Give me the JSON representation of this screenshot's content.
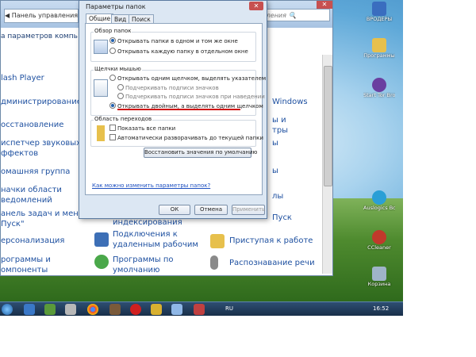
{
  "cp": {
    "address": "Панель управления",
    "search": "управления",
    "subheader": "а параметров компь",
    "view": "ры",
    "left_items": [
      "lash Player",
      "дминистрирование",
      "осстановление",
      "испетчер звуковых",
      "ффектов",
      "омашняя группа",
      "начки области",
      "ведомлений",
      "анель задач и меню",
      "Пуск\"",
      "ерсонализация",
      "рограммы и",
      "омпоненты"
    ],
    "mid_items": [
      "индексирования",
      "Подключения к",
      "удаленным рабочим",
      "Программы по",
      "умолчанию"
    ],
    "right_items": [
      "Windows",
      "ы и",
      "тры",
      "ы",
      "ы",
      "лы",
      "Пуск",
      "Приступая к работе",
      "Распознавание речи"
    ]
  },
  "dialog": {
    "title": "Параметры папок",
    "tabs": [
      "Общие",
      "Вид",
      "Поиск"
    ],
    "browse_group": "Обзор папок",
    "browse_same": "Открывать папки в одном и том же окне",
    "browse_separate": "Открывать каждую папку в отдельном окне",
    "click_group": "Щелчки мышью",
    "single_click": "Открывать одним щелчком, выделять указателем",
    "underline_system": "Подчеркивать подписи значков",
    "underline_hover": "Подчеркивать подписи значков при наведении",
    "double_click": "Открывать двойным, а выделять одним щелчком",
    "nav_group": "Область переходов",
    "show_all": "Показать все папки",
    "auto_expand": "Автоматически разворачивать до текущей папки",
    "restore": "Восстановить значения по умолчанию",
    "link": "Как можно изменить параметры папок?",
    "ok": "ОК",
    "cancel": "Отмена",
    "apply": "Применить"
  },
  "desktop": {
    "icons": [
      "ВРОДЕРЫ",
      "Программы",
      "Start Tor Browse...",
      "Auslogics BoostSpeed",
      "CCleaner",
      "Корзина"
    ]
  },
  "taskbar": {
    "lang": "RU",
    "time": "16:52"
  },
  "colors": {
    "accent": "#1e50a0",
    "highlight": "#d01010"
  }
}
